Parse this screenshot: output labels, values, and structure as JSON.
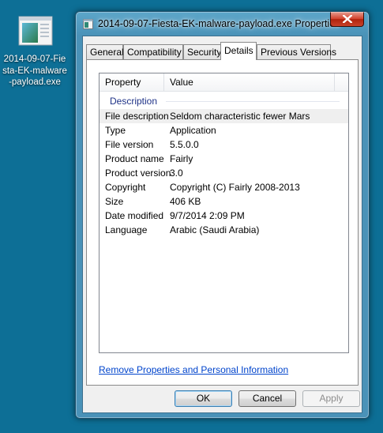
{
  "desktop": {
    "icon_label": "2014-09-07-Fiesta-EK-malware-payload.exe",
    "icon": "executable-file-icon"
  },
  "window": {
    "title": "2014-09-07-Fiesta-EK-malware-payload.exe Properties",
    "title_icon": "executable-file-icon",
    "close_icon": "close-icon"
  },
  "tabs": [
    {
      "label": "General"
    },
    {
      "label": "Compatibility"
    },
    {
      "label": "Security"
    },
    {
      "label": "Details",
      "active": true
    },
    {
      "label": "Previous Versions"
    }
  ],
  "details": {
    "columns": [
      "Property",
      "Value"
    ],
    "group": "Description",
    "rows": [
      {
        "property": "File description",
        "value": "Seldom characteristic fewer Mars"
      },
      {
        "property": "Type",
        "value": "Application"
      },
      {
        "property": "File version",
        "value": "5.5.0.0"
      },
      {
        "property": "Product name",
        "value": "Fairly"
      },
      {
        "property": "Product version",
        "value": "3.0"
      },
      {
        "property": "Copyright",
        "value": "Copyright (C) Fairly 2008-2013"
      },
      {
        "property": "Size",
        "value": "406 KB"
      },
      {
        "property": "Date modified",
        "value": "9/7/2014 2:09 PM"
      },
      {
        "property": "Language",
        "value": "Arabic (Saudi Arabia)"
      }
    ]
  },
  "link": "Remove Properties and Personal Information",
  "buttons": {
    "ok": "OK",
    "cancel": "Cancel",
    "apply": "Apply"
  },
  "colors": {
    "desktop_background": "#0d6f96",
    "link": "#0044cc",
    "group_header": "#1e3287"
  }
}
